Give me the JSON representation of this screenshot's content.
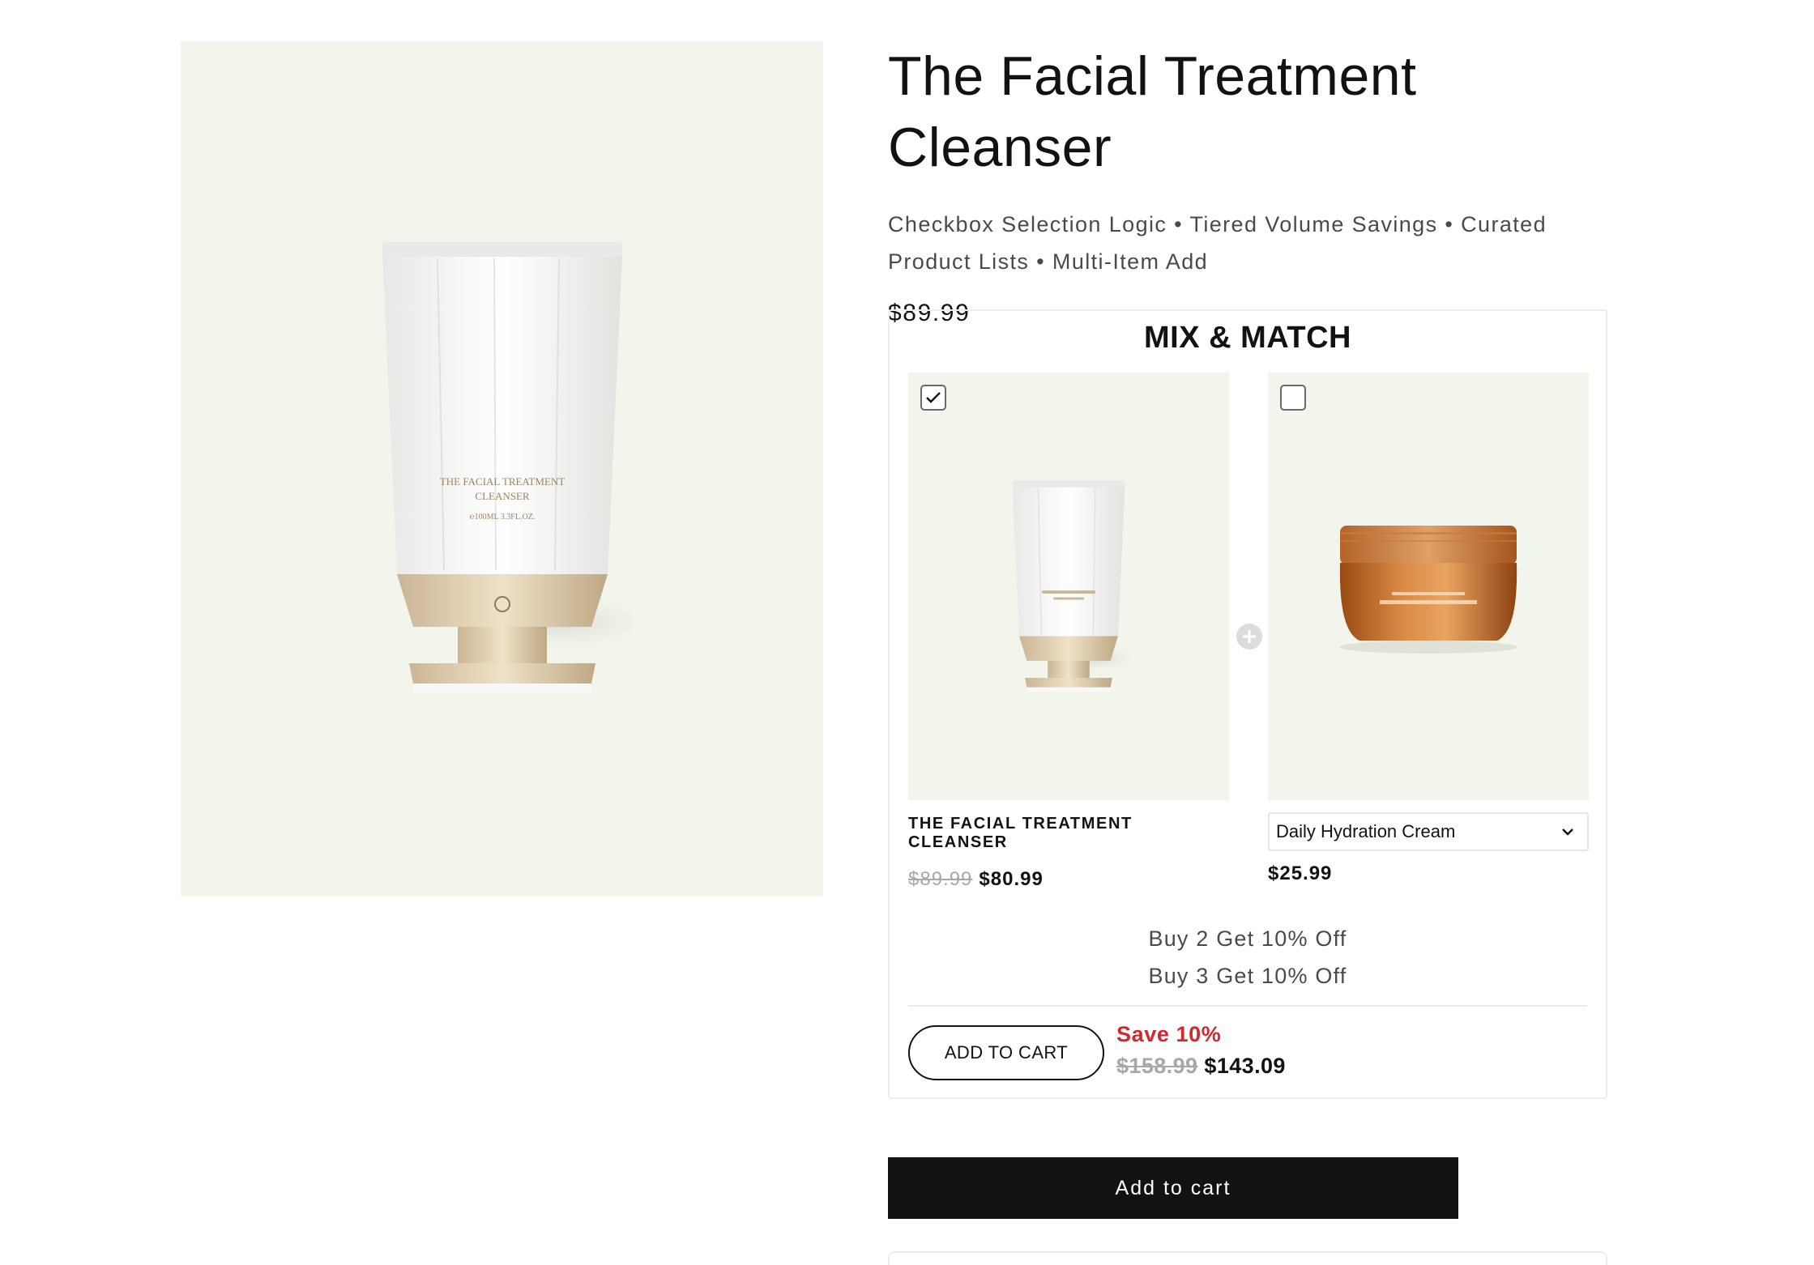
{
  "product": {
    "title": "The Facial Treatment Cleanser",
    "subtitle": "Checkbox Selection Logic • Tiered Volume Savings • Curated Product Lists • Multi-Item Add",
    "price": "$89.99"
  },
  "mix_match": {
    "title": "MIX & MATCH",
    "items": [
      {
        "checked": true,
        "name": "THE FACIAL TREATMENT CLEANSER",
        "old_price": "$89.99",
        "price": "$80.99"
      },
      {
        "checked": false,
        "selected_option": "Daily Hydration Cream",
        "price": "$25.99"
      }
    ],
    "tiers": [
      "Buy 2 Get 10% Off",
      "Buy 3 Get 10% Off"
    ],
    "add_button": "ADD TO CART",
    "save_label": "Save 10%",
    "total_old": "$158.99",
    "total_new": "$143.09"
  },
  "add_to_cart": "Add to cart",
  "colors": {
    "image_bg": "#f2f5ec",
    "save_red": "#d2282e",
    "button_black": "#121212"
  }
}
